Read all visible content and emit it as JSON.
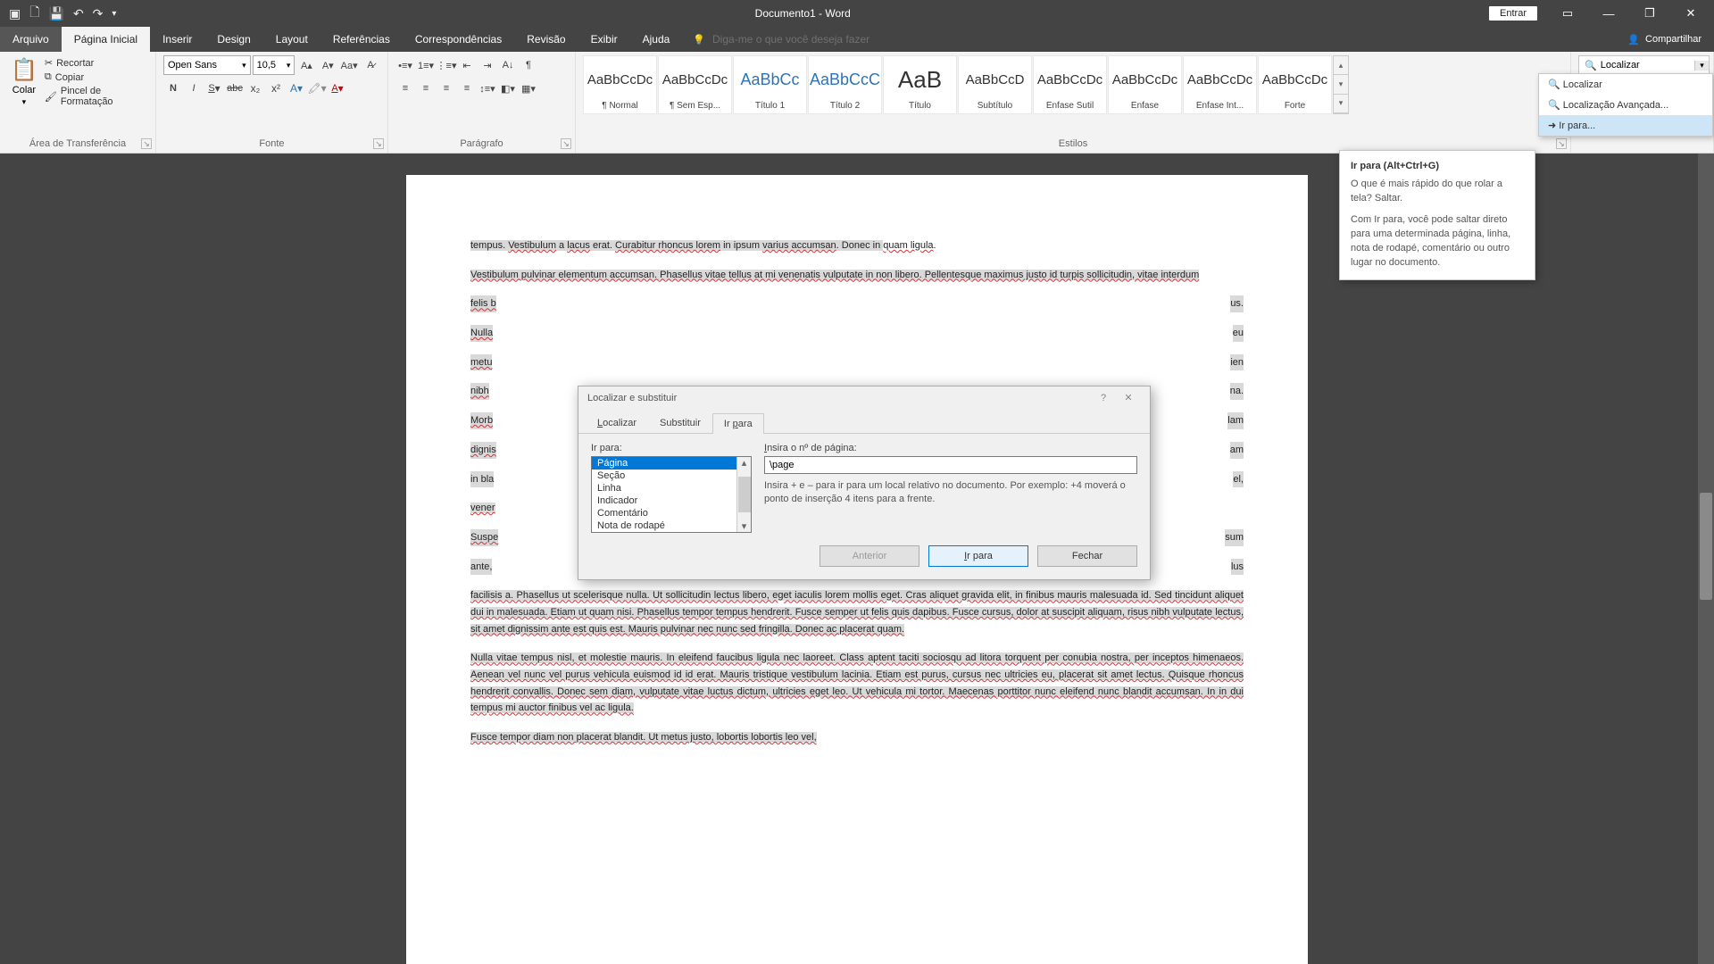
{
  "title": "Documento1 - Word",
  "qat": {
    "save": "💾",
    "undo": "↶",
    "redo": "↷"
  },
  "win": {
    "signin": "Entrar"
  },
  "tabs": {
    "file": "Arquivo",
    "home": "Página Inicial",
    "insert": "Inserir",
    "design": "Design",
    "layout": "Layout",
    "references": "Referências",
    "mailings": "Correspondências",
    "review": "Revisão",
    "view": "Exibir",
    "help": "Ajuda",
    "tellme_placeholder": "Diga-me o que você deseja fazer",
    "share": "Compartilhar"
  },
  "ribbon": {
    "clipboard": {
      "paste": "Colar",
      "cut": "Recortar",
      "copy": "Copiar",
      "painter": "Pincel de Formatação",
      "label": "Área de Transferência"
    },
    "font": {
      "name": "Open Sans",
      "size": "10,5",
      "label": "Fonte"
    },
    "paragraph": {
      "label": "Parágrafo"
    },
    "styles": {
      "label": "Estilos",
      "items": [
        {
          "sample": "AaBbCcDc",
          "name": "¶ Normal"
        },
        {
          "sample": "AaBbCcDc",
          "name": "¶ Sem Esp..."
        },
        {
          "sample": "AaBbCc",
          "name": "Título 1",
          "cls": "heading"
        },
        {
          "sample": "AaBbCcC",
          "name": "Título 2",
          "cls": "heading"
        },
        {
          "sample": "AaB",
          "name": "Título",
          "cls": "title"
        },
        {
          "sample": "AaBbCcD",
          "name": "Subtítulo"
        },
        {
          "sample": "AaBbCcDc",
          "name": "Ênfase Sutil"
        },
        {
          "sample": "AaBbCcDc",
          "name": "Ênfase"
        },
        {
          "sample": "AaBbCcDc",
          "name": "Ênfase Int..."
        },
        {
          "sample": "AaBbCcDc",
          "name": "Forte"
        }
      ]
    },
    "editing": {
      "find": "Localizar",
      "menu": {
        "find": "Localizar",
        "advanced": "Localização Avançada...",
        "goto": "Ir para..."
      }
    }
  },
  "tooltip": {
    "title": "Ir para (Alt+Ctrl+G)",
    "p1": "O que é mais rápido do que rolar a tela? Saltar.",
    "p2": "Com Ir para, você pode saltar direto para uma determinada página, linha, nota de rodapé, comentário ou outro lugar no documento."
  },
  "dialog": {
    "title": "Localizar e substituir",
    "tabs": {
      "find": "Localizar",
      "replace": "Substituir",
      "goto": "Ir para"
    },
    "goto_label": "Ir para:",
    "list": [
      "Página",
      "Seção",
      "Linha",
      "Indicador",
      "Comentário",
      "Nota de rodapé"
    ],
    "input_label": "Insira o nº de página:",
    "input_value": "\\page",
    "hint": "Insira + e – para ir para um local relativo no documento. Por exemplo: +4 moverá o ponto de inserção 4 itens para a frente.",
    "btn_prev": "Anterior",
    "btn_goto": "Ir para",
    "btn_close": "Fechar"
  },
  "doc": {
    "p1a": "tempus. ",
    "p1b": "Vestibulum",
    "p1c": " a ",
    "p1d": "lacus",
    "p1e": " erat. ",
    "p1f": "Curabitur rhoncus lorem",
    "p1g": " in ipsum ",
    "p1h": "varius accumsan",
    "p1i": ". Donec in ",
    "p1j": "quam ligula",
    "p1k": ".",
    "p2": "Vestibulum pulvinar elementum accumsan. Phasellus vitae tellus at mi venenatis vulputate in non libero. Pellentesque maximus justo id turpis sollicitudin, vitae interdum",
    "p2b": "felis b",
    "p2c": "us.",
    "p2d": "Nulla",
    "p2e": "eu",
    "p2f": "metu",
    "p2g": "ien",
    "p2h": "nibh",
    "p2i": "na.",
    "p2j": "Morb",
    "p2k": "lam",
    "p2l": "dignis",
    "p2m": "am",
    "p2n": "in bla",
    "p2o": "el,",
    "p2p": "vener",
    "p3a": "Suspe",
    "p3b": "sum",
    "p3c": "ante, ",
    "p3d": "lus",
    "p4": "facilisis a. Phasellus ut scelerisque nulla. Ut sollicitudin lectus libero, eget iaculis lorem mollis eget. Cras aliquet gravida elit, in finibus mauris malesuada id. Sed tincidunt aliquet dui in malesuada. Etiam ut quam nisi. Phasellus tempor tempus hendrerit. Fusce semper ut felis quis dapibus. Fusce cursus, dolor at suscipit aliquam, risus nibh vulputate lectus, sit amet dignissim ante est quis est. Mauris pulvinar nec nunc sed fringilla. Donec ac placerat quam.",
    "p5": "Nulla vitae tempus nisl, et molestie mauris. In eleifend faucibus ligula nec laoreet. Class aptent taciti sociosqu ad litora torquent per conubia nostra, per inceptos himenaeos. Aenean vel nunc vel purus vehicula euismod id id erat. Mauris tristique vestibulum lacinia. Etiam est purus, cursus nec ultricies eu, placerat sit amet lectus. Quisque rhoncus hendrerit convallis. Donec sem diam, vulputate vitae luctus dictum, ultricies eget leo. Ut vehicula mi tortor. Maecenas porttitor nunc eleifend nunc blandit accumsan. In in dui tempus mi auctor finibus vel ac ligula.",
    "p6": "Fusce tempor diam non placerat blandit. Ut metus justo, lobortis lobortis leo vel,"
  }
}
